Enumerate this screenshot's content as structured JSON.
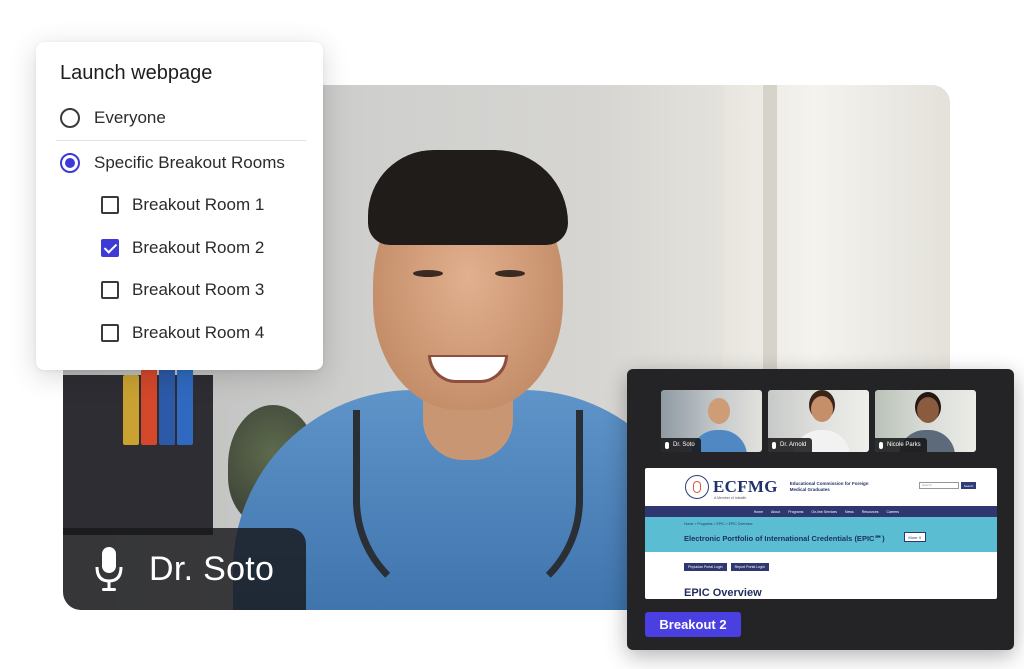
{
  "main_video": {
    "participant_name": "Dr. Soto",
    "icons": [
      "microphone-icon"
    ]
  },
  "popup": {
    "title": "Launch webpage",
    "options": [
      {
        "label": "Everyone",
        "selected": false
      },
      {
        "label": "Specific Breakout Rooms",
        "selected": true
      }
    ],
    "rooms": [
      {
        "label": "Breakout Room 1",
        "checked": false
      },
      {
        "label": "Breakout Room 2",
        "checked": true
      },
      {
        "label": "Breakout Room 3",
        "checked": false
      },
      {
        "label": "Breakout Room 4",
        "checked": false
      }
    ]
  },
  "breakout_panel": {
    "thumbnails": [
      {
        "name": "Dr. Soto"
      },
      {
        "name": "Dr. Arnold"
      },
      {
        "name": "Nicole Parks"
      }
    ],
    "webpage": {
      "logo": "ECFMG",
      "logo_sub": "A Member of Intealth",
      "org_name": "Educational Commission for Foreign Medical Graduates",
      "search_placeholder": "Search",
      "search_button": "Search",
      "nav": [
        "Home",
        "About",
        "Programs",
        "On-line Services",
        "News",
        "Resources",
        "Careers"
      ],
      "breadcrumb": "Home  >  Programs  >  EPIC  >  EPIC Overview",
      "hero_title": "Electronic Portfolio of International Credentials (EPIC℠)",
      "more_button": "More ∨",
      "portal_buttons": [
        "Physician Portal Login",
        "Report Portal Login"
      ],
      "section_heading": "EPIC Overview"
    },
    "room_button": "Breakout 2"
  },
  "colors": {
    "accent": "#3e3ad8",
    "panel_bg": "#242426",
    "button": "#4a3fe0"
  }
}
